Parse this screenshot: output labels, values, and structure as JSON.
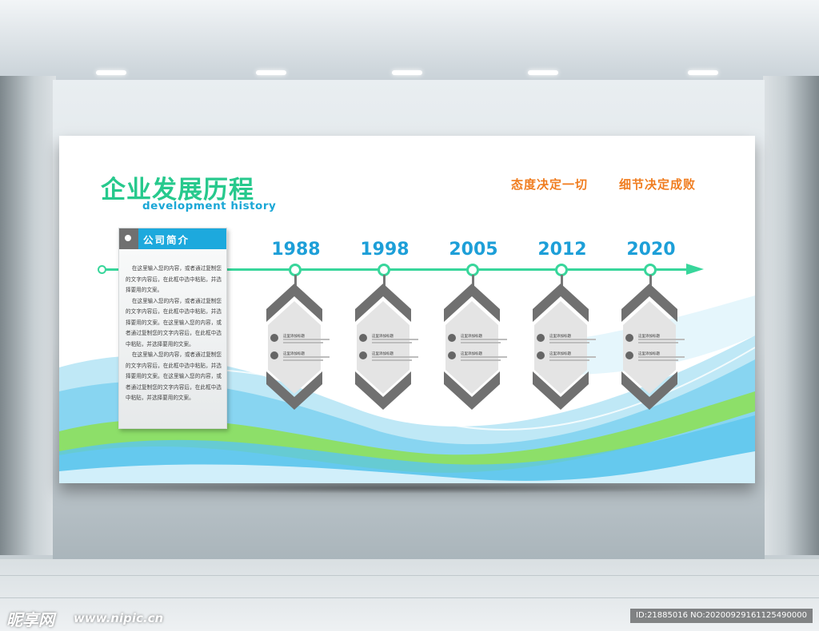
{
  "scene": {
    "watermark_logo": "昵享网",
    "watermark_url": "www.nipic.cn",
    "watermark_id": "ID:21885016 NO:20200929161125490000"
  },
  "board": {
    "title": "企业发展历程",
    "subtitle": "development history",
    "slogans": [
      "态度决定一切",
      "细节决定成败"
    ],
    "colors": {
      "title": "#27c98d",
      "subtitle": "#1aa7d6",
      "slogan": "#f07d20",
      "timeline": "#38d69b",
      "year": "#1d9fd8",
      "chevron": "#707070"
    }
  },
  "intro": {
    "title": "公司简介",
    "paragraphs": [
      "在这里输入您的内容，或者通过复制您的文字内容后，在此框中选中粘贴，并选择要用的文案。",
      "在这里输入您的内容，或者通过复制您的文字内容后，在此框中选中粘贴，并选择要用的文案。在这里输入您的内容，或者通过复制您的文字内容后，在此框中选中粘贴，并选择要用的文案。",
      "在这里输入您的内容，或者通过复制您的文字内容后，在此框中选中粘贴，并选择要用的文案。在这里输入您的内容，或者通过复制您的文字内容后，在此框中选中粘贴，并选择要用的文案。"
    ]
  },
  "timeline": {
    "nodes": [
      {
        "year": "1988",
        "items": [
          {
            "title": "这里添加标题"
          },
          {
            "title": "这里添加标题"
          }
        ]
      },
      {
        "year": "1998",
        "items": [
          {
            "title": "这里添加标题"
          },
          {
            "title": "这里添加标题"
          }
        ]
      },
      {
        "year": "2005",
        "items": [
          {
            "title": "这里添加标题"
          },
          {
            "title": "这里添加标题"
          }
        ]
      },
      {
        "year": "2012",
        "items": [
          {
            "title": "这里添加标题"
          },
          {
            "title": "这里添加标题"
          }
        ]
      },
      {
        "year": "2020",
        "items": [
          {
            "title": "这里添加标题"
          },
          {
            "title": "这里添加标题"
          }
        ]
      }
    ]
  }
}
